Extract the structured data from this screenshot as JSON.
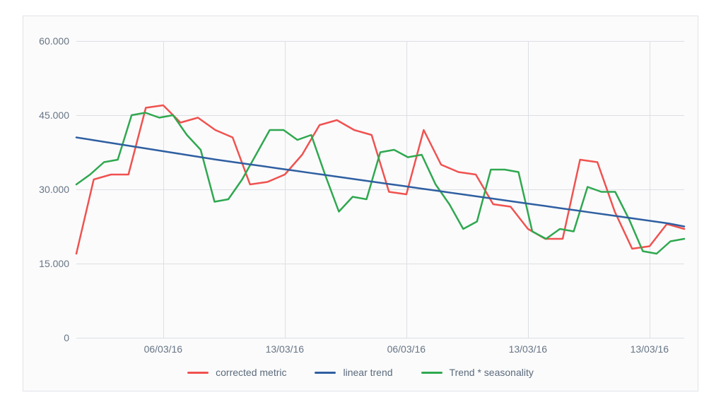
{
  "chart_data": {
    "type": "line",
    "ylim": [
      0,
      60
    ],
    "y_ticks": [
      0,
      15,
      30,
      45,
      60
    ],
    "y_tick_labels": [
      "0",
      "15.000",
      "30.000",
      "45.000",
      "60.000"
    ],
    "x_count": 36,
    "x_gridlines": [
      5,
      12,
      19,
      26,
      33
    ],
    "x_tick_labels": [
      "06/03/16",
      "13/03/16",
      "06/03/16",
      "13/03/16",
      "13/03/16"
    ],
    "series": [
      {
        "name": "corrected metric",
        "color": "#f0524f",
        "values": [
          17,
          32,
          33,
          33,
          46.5,
          47,
          43.5,
          44.5,
          42,
          40.5,
          31,
          31.5,
          33,
          37,
          43,
          44,
          42,
          41,
          29.5,
          29,
          42,
          35,
          33.5,
          33,
          27,
          26.5,
          22,
          20,
          20,
          36,
          35.5,
          25.5,
          18,
          18.5,
          23,
          22
        ]
      },
      {
        "name": "linear trend",
        "color": "#2f5fa1",
        "values": [
          40.5,
          40.0,
          39.5,
          39.0,
          38.5,
          38.0,
          37.5,
          37.0,
          36.5,
          36.0,
          35.56,
          35.11,
          34.67,
          34.22,
          33.78,
          33.33,
          32.89,
          32.44,
          32.0,
          31.56,
          31.11,
          30.67,
          30.22,
          29.78,
          29.33,
          28.89,
          28.44,
          28.0,
          27.56,
          27.11,
          26.67,
          26.22,
          25.78,
          25.33,
          24.89,
          24.44,
          24.0,
          23.56,
          23.11,
          22.5
        ]
      },
      {
        "name": "Trend * seasonality",
        "color": "#2fa84f",
        "values": [
          31,
          33,
          35.5,
          36,
          45,
          45.5,
          44.5,
          45,
          41,
          38,
          27.5,
          28,
          32,
          37,
          42,
          42,
          40,
          41,
          33,
          25.5,
          28.5,
          28,
          37.5,
          38,
          36.5,
          37,
          31,
          27,
          22,
          23.5,
          34,
          34,
          33.5,
          21.5,
          20,
          22,
          21.5,
          30.5,
          29.5,
          29.5,
          24,
          17.5,
          17,
          19.5,
          20
        ]
      }
    ],
    "legend": [
      {
        "label": "corrected metric",
        "color": "#f0524f"
      },
      {
        "label": "linear trend",
        "color": "#2f5fa1"
      },
      {
        "label": "Trend * seasonality",
        "color": "#2fa84f"
      }
    ]
  }
}
